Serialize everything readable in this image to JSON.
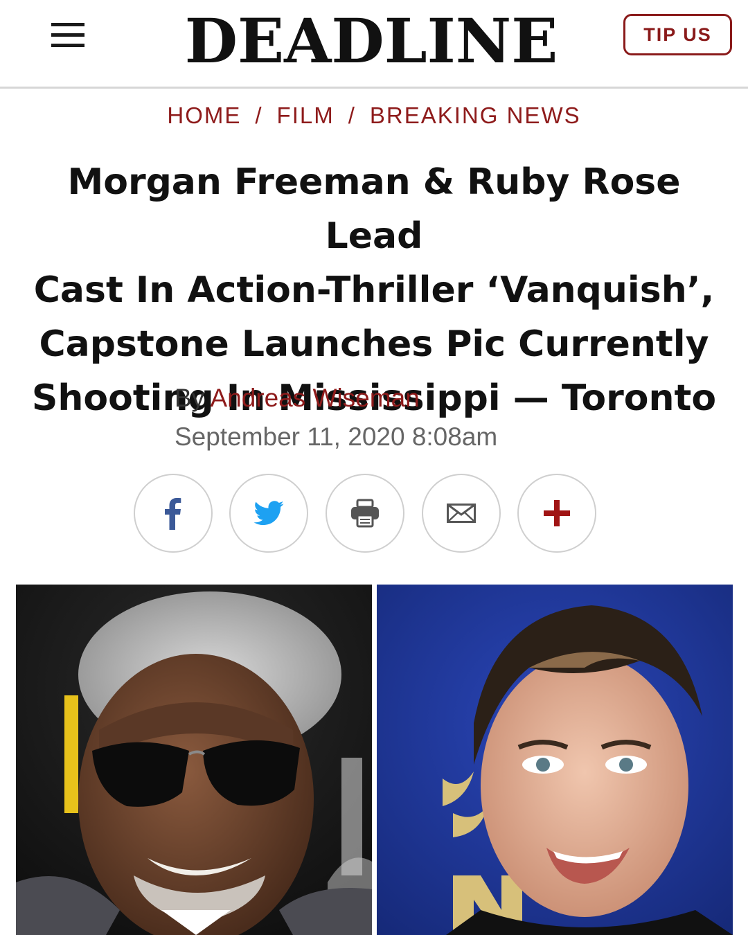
{
  "header": {
    "logo": "DEADLINE",
    "tip_label": "TIP US"
  },
  "breadcrumb": {
    "items": [
      "HOME",
      "FILM",
      "BREAKING NEWS"
    ],
    "separator": "/"
  },
  "article": {
    "headline_lines": [
      "Morgan Freeman & Ruby Rose Lead",
      "Cast In Action-Thriller ‘Vanquish’,",
      "Capstone Launches Pic Currently",
      "Shooting In Mississippi — Toronto"
    ],
    "byline_prefix": "By",
    "author": "Andreas Wiseman",
    "date": "September 11, 2020 8:08am"
  },
  "share": {
    "buttons": [
      "facebook-icon",
      "twitter-icon",
      "print-icon",
      "email-icon",
      "plus-icon"
    ],
    "facebook_color": "#3b5998",
    "twitter_color": "#1da1f2",
    "accent_color": "#8e1b1b"
  },
  "photos": {
    "left": "Morgan Freeman photo",
    "right": "Ruby Rose photo"
  }
}
